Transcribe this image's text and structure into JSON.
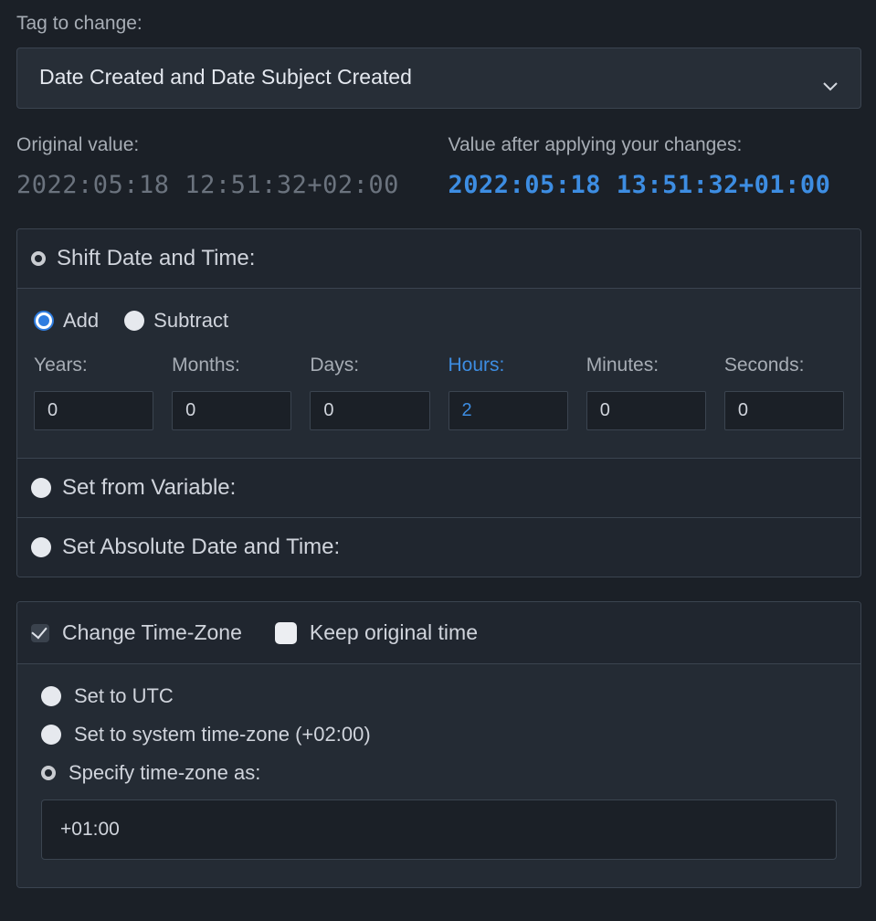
{
  "tagLabel": "Tag to change:",
  "tagSelected": "Date Created and Date Subject Created",
  "originalLabel": "Original value:",
  "afterLabel": "Value after applying your changes:",
  "originalValue": "2022:05:18 12:51:32+02:00",
  "afterValue": "2022:05:18 13:51:32+01:00",
  "shift": {
    "title": "Shift Date and Time:",
    "addLabel": "Add",
    "subLabel": "Subtract",
    "fields": {
      "years": {
        "label": "Years:",
        "value": "0"
      },
      "months": {
        "label": "Months:",
        "value": "0"
      },
      "days": {
        "label": "Days:",
        "value": "0"
      },
      "hours": {
        "label": "Hours:",
        "value": "2"
      },
      "minutes": {
        "label": "Minutes:",
        "value": "0"
      },
      "seconds": {
        "label": "Seconds:",
        "value": "0"
      }
    }
  },
  "setVarTitle": "Set from Variable:",
  "setAbsTitle": "Set Absolute Date and Time:",
  "tz": {
    "changeLabel": "Change Time-Zone",
    "keepLabel": "Keep original time",
    "utcLabel": "Set to UTC",
    "systemLabel": "Set to system time-zone (+02:00)",
    "specifyLabel": "Specify time-zone as:",
    "specifyValue": "+01:00"
  }
}
